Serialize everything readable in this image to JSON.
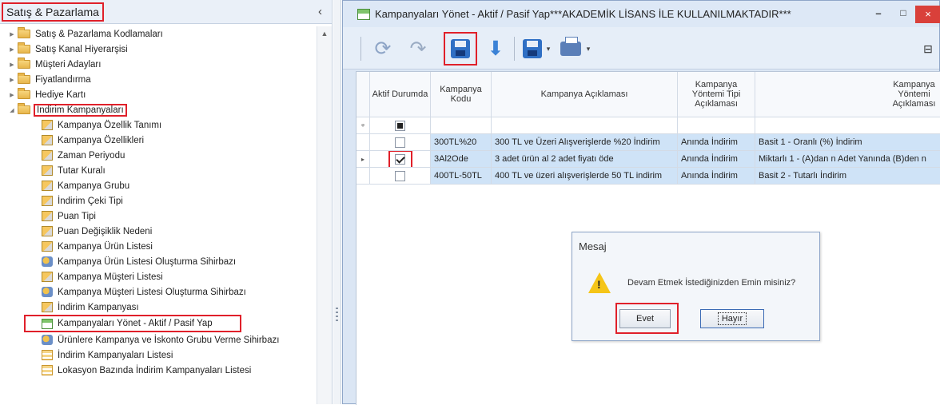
{
  "left_panel": {
    "title": "Satış & Pazarlama",
    "collapse_glyph": "‹",
    "tree": [
      {
        "label": "Satış & Pazarlama Kodlamaları",
        "level": 1,
        "icon": "folder-icon",
        "expanded": false
      },
      {
        "label": "Satış Kanal Hiyerarşisi",
        "level": 1,
        "icon": "folder-icon",
        "expanded": false
      },
      {
        "label": "Müşteri Adayları",
        "level": 1,
        "icon": "folder-icon",
        "expanded": false
      },
      {
        "label": "Fiyatlandırma",
        "level": 1,
        "icon": "folder-icon",
        "expanded": false
      },
      {
        "label": "Hediye Kartı",
        "level": 1,
        "icon": "folder-icon",
        "expanded": false
      },
      {
        "label": "İndirim Kampanyaları",
        "level": 1,
        "icon": "folder-icon",
        "expanded": true
      },
      {
        "label": "Kampanya Özellik Tanımı",
        "level": 2,
        "icon": "document-icon"
      },
      {
        "label": "Kampanya Özellikleri",
        "level": 2,
        "icon": "document-icon"
      },
      {
        "label": "Zaman Periyodu",
        "level": 2,
        "icon": "document-icon"
      },
      {
        "label": "Tutar Kuralı",
        "level": 2,
        "icon": "document-icon"
      },
      {
        "label": "Kampanya Grubu",
        "level": 2,
        "icon": "document-icon"
      },
      {
        "label": "İndirim Çeki Tipi",
        "level": 2,
        "icon": "document-icon"
      },
      {
        "label": "Puan Tipi",
        "level": 2,
        "icon": "document-icon"
      },
      {
        "label": "Puan Değişiklik Nedeni",
        "level": 2,
        "icon": "document-icon"
      },
      {
        "label": "Kampanya Ürün Listesi",
        "level": 2,
        "icon": "document-icon"
      },
      {
        "label": "Kampanya Ürün Listesi Oluşturma Sihirbazı",
        "level": 2,
        "icon": "wizard-icon"
      },
      {
        "label": "Kampanya Müşteri Listesi",
        "level": 2,
        "icon": "document-icon"
      },
      {
        "label": "Kampanya Müşteri Listesi Oluşturma Sihirbazı",
        "level": 2,
        "icon": "wizard-icon"
      },
      {
        "label": "İndirim Kampanyası",
        "level": 2,
        "icon": "document-icon"
      },
      {
        "label": "Kampanyaları Yönet - Aktif / Pasif Yap",
        "level": 2,
        "icon": "grid-icon"
      },
      {
        "label": "Ürünlere Kampanya ve İskonto Grubu Verme Sihirbazı",
        "level": 2,
        "icon": "wizard-icon"
      },
      {
        "label": "İndirim Kampanyaları Listesi",
        "level": 2,
        "icon": "list-icon"
      },
      {
        "label": "Lokasyon Bazında İndirim Kampanyaları Listesi",
        "level": 2,
        "icon": "list-icon"
      }
    ]
  },
  "window": {
    "title": "Kampanyaları Yönet - Aktif / Pasif Yap***AKADEMİK LİSANS İLE KULLANILMAKTADIR***",
    "min_glyph": "–",
    "max_glyph": "□",
    "close_glyph": "×",
    "toolbar": {
      "refresh_glyph": "⟳",
      "redo_glyph": "↷",
      "down_glyph": "⬇",
      "dropdown_glyph": "▾",
      "right_glyph": "⊟"
    }
  },
  "grid": {
    "headers": [
      "Aktif Durumda",
      "Kampanya Kodu",
      "Kampanya Açıklaması",
      "Kampanya Yöntemi Tipi Açıklaması",
      "Kampanya Yöntemi Açıklaması"
    ],
    "filter_glyph": "ᵠ",
    "current_row_glyph": "▸",
    "rows": [
      {
        "active": false,
        "code": "300TL%20",
        "desc": "300 TL ve Üzeri Alışverişlerde %20 İndirim",
        "method_type": "Anında İndirim",
        "method": "Basit 1 - Oranlı (%) İndirim"
      },
      {
        "active": true,
        "code": "3Al2Ode",
        "desc": "3 adet ürün al 2 adet fiyatı öde",
        "method_type": "Anında İndirim",
        "method": "Miktarlı 1 - (A)dan n Adet Yanında (B)den n"
      },
      {
        "active": false,
        "code": "400TL-50TL",
        "desc": "400 TL ve üzeri alışverişlerde 50 TL indirim",
        "method_type": "Anında İndirim",
        "method": "Basit 2 - Tutarlı İndirim"
      }
    ]
  },
  "dialog": {
    "title": "Mesaj",
    "message": "Devam Etmek İstediğinizden Emin misiniz?",
    "warning_mark": "!",
    "yes_label": "Evet",
    "no_label": "Hayır"
  }
}
